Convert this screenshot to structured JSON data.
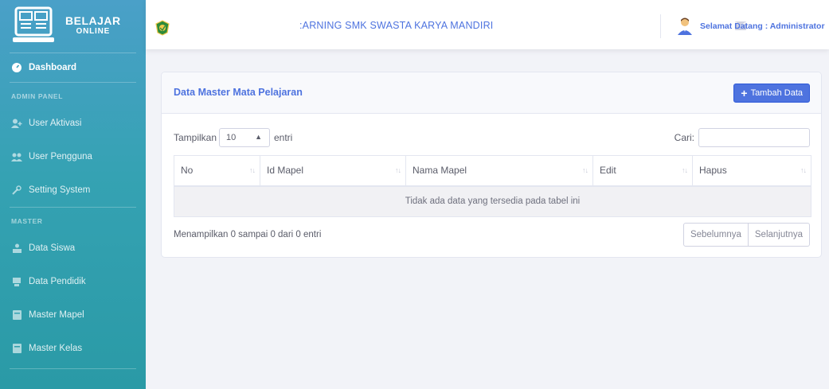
{
  "brand": {
    "line1": "BELAJAR",
    "line2": "ONLINE"
  },
  "sidebar": {
    "dashboard": "Dashboard",
    "section_admin": "ADMIN PANEL",
    "admin_items": [
      {
        "label": "User Aktivasi",
        "icon": "user-plus-icon"
      },
      {
        "label": "User Pengguna",
        "icon": "users-icon"
      },
      {
        "label": "Setting System",
        "icon": "wrench-icon"
      }
    ],
    "section_master": "MASTER",
    "master_items": [
      {
        "label": "Data Siswa",
        "icon": "students-icon"
      },
      {
        "label": "Data Pendidik",
        "icon": "teacher-icon"
      },
      {
        "label": "Master Mapel",
        "icon": "book-icon"
      },
      {
        "label": "Master Kelas",
        "icon": "book-icon"
      }
    ]
  },
  "topbar": {
    "title": ":ARNING SMK SWASTA KARYA MANDIRI",
    "welcome": "Selamat Datang : Administrator"
  },
  "card": {
    "title": "Data Master Mata Pelajaran",
    "add_button": "Tambah Data"
  },
  "table_controls": {
    "length_label": "Tampilkan",
    "length_value": "10",
    "length_after": "entri",
    "search_label": "Cari:",
    "search_value": ""
  },
  "table": {
    "columns": [
      "No",
      "Id Mapel",
      "Nama Mapel",
      "Edit",
      "Hapus"
    ],
    "empty_message": "Tidak ada data yang tersedia pada tabel ini"
  },
  "footer": {
    "info": "Menampilkan 0 sampai 0 dari 0 entri",
    "prev": "Sebelumnya",
    "next": "Selanjutnya"
  },
  "colors": {
    "primary": "#4e73df",
    "sidebar_top": "#4aa0c8",
    "sidebar_bottom": "#2a9aa6"
  }
}
